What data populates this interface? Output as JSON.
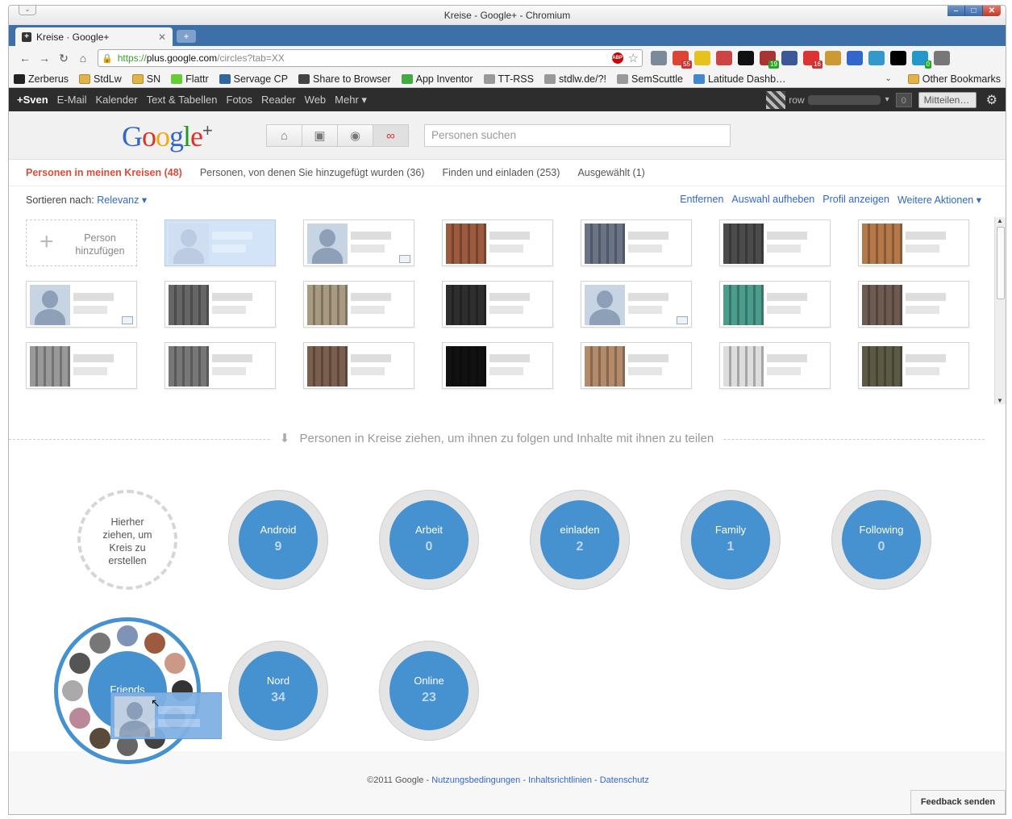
{
  "window": {
    "title": "Kreise - Google+ - Chromium",
    "menu_glyph": "⌄",
    "min_glyph": "–",
    "max_glyph": "□",
    "close_glyph": "✕"
  },
  "tab": {
    "title": "Kreise · Google+",
    "favicon": "+",
    "close_glyph": "✕",
    "new_tab_glyph": "+"
  },
  "toolbar": {
    "back": "←",
    "forward": "→",
    "reload": "↻",
    "home": "⌂",
    "url_scheme": "https://",
    "url_host": "plus.google.com",
    "url_path": "/circles?tab=XX",
    "lock_glyph": "🔒",
    "abp_label": "ABP",
    "star_glyph": "☆",
    "extensions": [
      {
        "name": "ext-circle-icon",
        "color": "#7a8a99",
        "badge": ""
      },
      {
        "name": "ext-check-icon",
        "color": "#d43",
        "badge": "55"
      },
      {
        "name": "ext-phone-icon",
        "color": "#e8c21c",
        "badge": ""
      },
      {
        "name": "ext-red-icon",
        "color": "#c44",
        "badge": ""
      },
      {
        "name": "ext-ball-icon",
        "color": "#111",
        "badge": ""
      },
      {
        "name": "ext-list-icon",
        "color": "#a33",
        "badge": "19",
        "badge_green": true
      },
      {
        "name": "ext-facebook-icon",
        "color": "#3b5998",
        "badge": ""
      },
      {
        "name": "ext-gmail-icon",
        "color": "#d33",
        "badge": "16"
      },
      {
        "name": "ext-basket-icon",
        "color": "#c93",
        "badge": ""
      },
      {
        "name": "ext-globe-icon",
        "color": "#36c",
        "badge": ""
      },
      {
        "name": "ext-gear-icon",
        "color": "#39c",
        "badge": ""
      },
      {
        "name": "ext-instapaper-icon",
        "color": "#000",
        "badge": ""
      },
      {
        "name": "ext-lock-icon",
        "color": "#29c",
        "badge": "0",
        "badge_green": true
      },
      {
        "name": "ext-wrench-icon",
        "color": "#777",
        "badge": ""
      }
    ]
  },
  "bookmarks": {
    "items": [
      {
        "label": "Zerberus",
        "color": "#222"
      },
      {
        "label": "StdLw",
        "color": "#e0b34b",
        "folder": true
      },
      {
        "label": "SN",
        "color": "#e0b34b",
        "folder": true
      },
      {
        "label": "Flattr",
        "color": "#6c3"
      },
      {
        "label": "Servage CP",
        "color": "#369"
      },
      {
        "label": "Share to Browser",
        "color": "#444"
      },
      {
        "label": "App Inventor",
        "color": "#4a4"
      },
      {
        "label": "TT-RSS",
        "color": "#999"
      },
      {
        "label": "stdlw.de/?!",
        "color": "#999"
      },
      {
        "label": "SemScuttle",
        "color": "#999"
      },
      {
        "label": "Latitude Dashb…",
        "color": "#48c"
      }
    ],
    "chevron": "⌄",
    "other": "Other Bookmarks"
  },
  "gbar": {
    "items": [
      "+Sven",
      "E-Mail",
      "Kalender",
      "Text & Tabellen",
      "Fotos",
      "Reader",
      "Web",
      "Mehr ▾"
    ],
    "user": "row",
    "user_dropdown": "▾",
    "notif_count": "0",
    "share": "Mitteilen…",
    "gear": "⚙"
  },
  "header": {
    "logo_letters": [
      {
        "ch": "G",
        "color": "#3366cc"
      },
      {
        "ch": "o",
        "color": "#dd3322"
      },
      {
        "ch": "o",
        "color": "#eeaa11"
      },
      {
        "ch": "g",
        "color": "#3366cc"
      },
      {
        "ch": "l",
        "color": "#229922"
      },
      {
        "ch": "e",
        "color": "#dd3322"
      }
    ],
    "logo_plus": "+",
    "nav": [
      {
        "name": "home-nav-icon",
        "glyph": "⌂"
      },
      {
        "name": "photos-nav-icon",
        "glyph": "▣"
      },
      {
        "name": "profile-nav-icon",
        "glyph": "◉"
      },
      {
        "name": "circles-nav-icon",
        "glyph": "∞",
        "active": true
      }
    ],
    "search_placeholder": "Personen suchen"
  },
  "tabs": [
    {
      "label": "Personen in meinen Kreisen (48)",
      "active": true
    },
    {
      "label": "Personen, von denen Sie hinzugefügt wurden (36)"
    },
    {
      "label": "Finden und einladen (253)"
    },
    {
      "label": "Ausgewählt (1)"
    }
  ],
  "sort": {
    "label": "Sortieren nach:",
    "value": "Relevanz ▾"
  },
  "actions": [
    "Entfernen",
    "Auswahl aufheben",
    "Profil anzeigen",
    "Weitere Aktionen ▾"
  ],
  "add_person": {
    "plus": "+",
    "label": "Person hinzufügen"
  },
  "people": [
    {
      "type": "default",
      "selected": true
    },
    {
      "type": "default",
      "mail": true,
      "color": "#7f93b7"
    },
    {
      "type": "photo",
      "color": "#9c5a3e"
    },
    {
      "type": "photo",
      "color": "#6b7487"
    },
    {
      "type": "photo",
      "color": "#4b4b4b"
    },
    {
      "type": "photo",
      "color": "#b57848"
    },
    {
      "type": "default",
      "mail": true,
      "color": "#8ea0c0"
    },
    {
      "type": "photo",
      "color": "#666"
    },
    {
      "type": "photo",
      "color": "#a89a80"
    },
    {
      "type": "photo",
      "color": "#2e2e2e"
    },
    {
      "type": "default",
      "mail": true,
      "color": "#8ea0c0"
    },
    {
      "type": "photo",
      "color": "#4a9c8c"
    },
    {
      "type": "photo",
      "color": "#6d5a50"
    },
    {
      "type": "photo",
      "color": "#999"
    },
    {
      "type": "photo",
      "color": "#777"
    },
    {
      "type": "photo",
      "color": "#7a5e4e"
    },
    {
      "type": "photo",
      "color": "#111"
    },
    {
      "type": "photo",
      "color": "#b38a6a"
    },
    {
      "type": "photo",
      "color": "#ddd"
    },
    {
      "type": "photo",
      "color": "#5c5a44"
    }
  ],
  "drag_hint": {
    "arrow": "⬇",
    "text": "Personen in Kreise ziehen, um ihnen zu folgen und Inhalte mit ihnen zu teilen"
  },
  "new_circle": "Hierher ziehen, um Kreis zu erstellen",
  "circles": [
    {
      "name": "Android",
      "count": "9"
    },
    {
      "name": "Arbeit",
      "count": "0"
    },
    {
      "name": "einladen",
      "count": "2"
    },
    {
      "name": "Family",
      "count": "1"
    },
    {
      "name": "Following",
      "count": "0"
    },
    {
      "name": "Nord",
      "count": "34"
    },
    {
      "name": "Online",
      "count": "23"
    }
  ],
  "friends_circle": {
    "name": "Friends",
    "member_colors": [
      "#7f93b7",
      "#9c5a3e",
      "#c98",
      "#333",
      "#556",
      "#444",
      "#666",
      "#5a4a3a",
      "#b89",
      "#aaa",
      "#555",
      "#777"
    ]
  },
  "cursor": "↖",
  "footer": {
    "copyright": "©2011 Google - ",
    "links": [
      "Nutzungsbedingungen",
      "Inhaltsrichtlinien",
      "Datenschutz"
    ],
    "separator": " - "
  },
  "feedback": "Feedback senden"
}
